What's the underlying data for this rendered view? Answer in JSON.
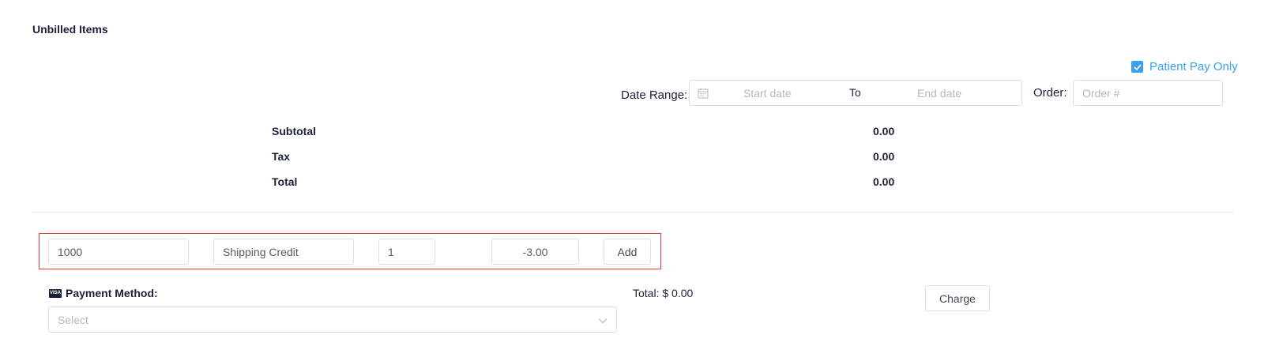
{
  "section": {
    "title": "Unbilled Items"
  },
  "filters": {
    "patient_pay_only_label": "Patient Pay Only",
    "patient_pay_only_checked": true,
    "date_range_label": "Date Range:",
    "start_placeholder": "Start date",
    "to_label": "To",
    "end_placeholder": "End date",
    "order_label": "Order:",
    "order_placeholder": "Order #"
  },
  "summary": {
    "subtotal_label": "Subtotal",
    "subtotal_value": "0.00",
    "tax_label": "Tax",
    "tax_value": "0.00",
    "total_label": "Total",
    "total_value": "0.00"
  },
  "add_row": {
    "code_value": "1000",
    "description_value": "Shipping Credit",
    "quantity_value": "1",
    "amount_value": "-3.00",
    "add_button_label": "Add"
  },
  "payment": {
    "method_label": "Payment Method:",
    "card_icon_text": "VISA",
    "select_placeholder": "Select",
    "total_text": "Total: $ 0.00",
    "charge_button_label": "Charge"
  },
  "colors": {
    "accent": "#3ba0f0",
    "highlight_border": "#e53a3a",
    "text": "#1c1f3a"
  }
}
